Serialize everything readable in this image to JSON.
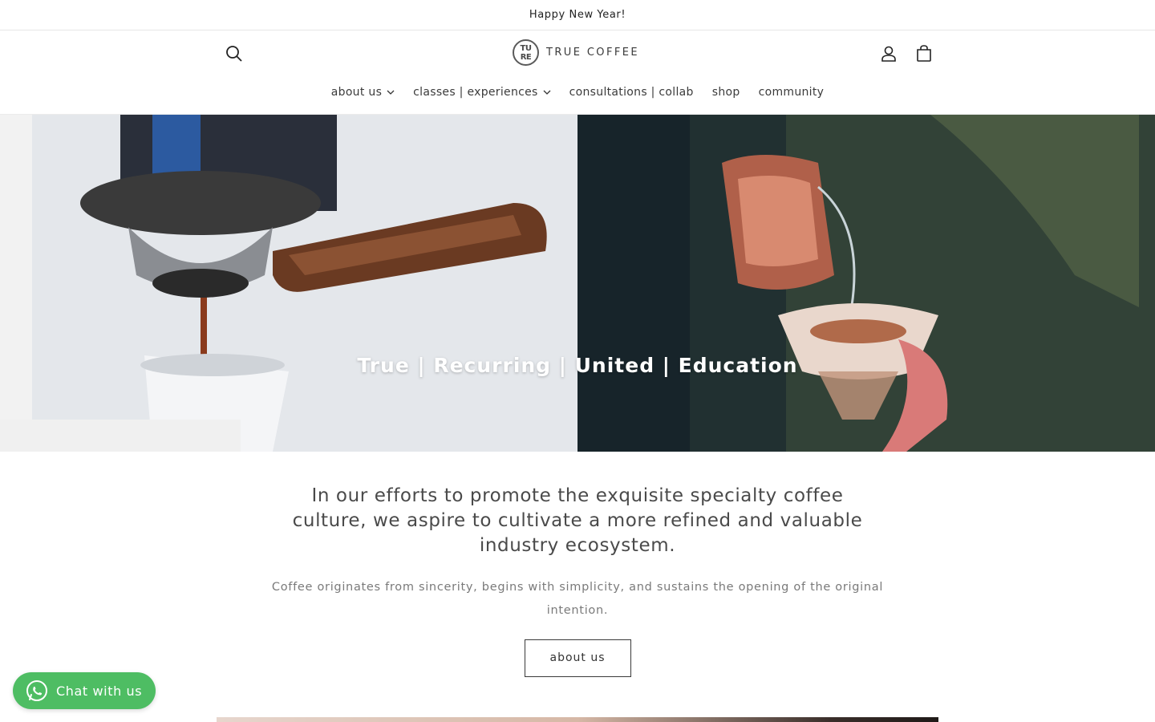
{
  "announcement": {
    "text": "Happy New Year!"
  },
  "header": {
    "logo_mark_top": "TU",
    "logo_mark_bottom": "RE",
    "logo_text": "TRUE COFFEE"
  },
  "nav": {
    "items": [
      {
        "label": "about us",
        "has_dropdown": true
      },
      {
        "label": "classes | experiences",
        "has_dropdown": true
      },
      {
        "label": "consultations | collab",
        "has_dropdown": false
      },
      {
        "label": "shop",
        "has_dropdown": false
      },
      {
        "label": "community",
        "has_dropdown": false
      }
    ]
  },
  "hero": {
    "title": "True | Recurring | United | Education"
  },
  "intro": {
    "heading": "In our efforts to promote the exquisite specialty coffee culture, we aspire to cultivate a more refined and valuable industry ecosystem.",
    "body": "Coffee originates from sincerity, begins with simplicity, and sustains the opening of the original intention.",
    "button_label": "about us"
  },
  "chat": {
    "label": "Chat with us",
    "color": "#4ebd63"
  }
}
